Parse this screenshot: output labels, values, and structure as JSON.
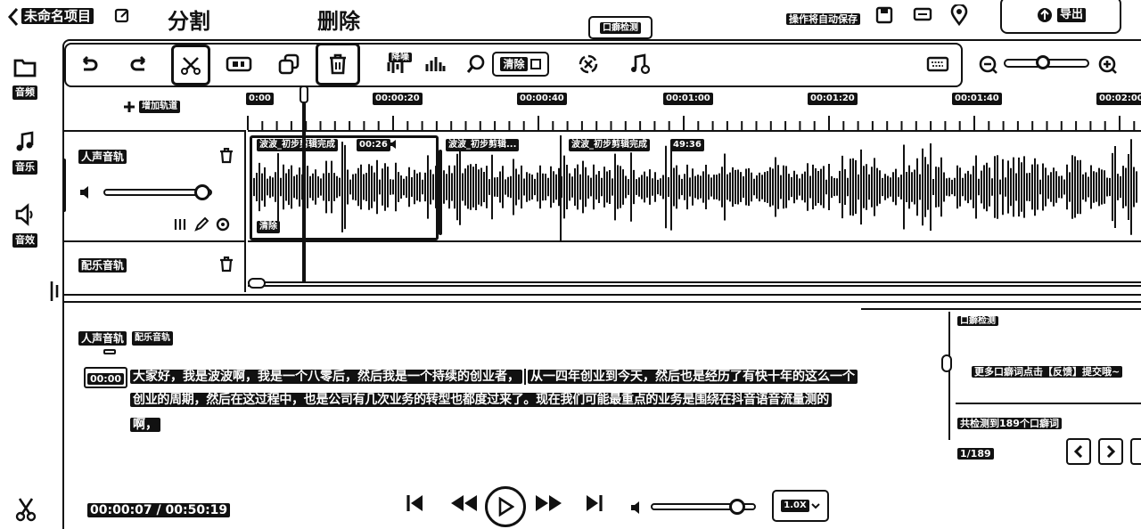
{
  "header": {
    "back_icon": "chevron-left-icon",
    "project_title": "未命名项目",
    "edit_icon": "edit-icon",
    "autosave_text": "操作将自动保存",
    "export_label": "导出",
    "annot_split": "分割",
    "annot_delete": "删除",
    "tooltip": "口癖检测"
  },
  "sidebar": {
    "items": [
      {
        "label": "音频",
        "icon": "folder-icon"
      },
      {
        "label": "音乐",
        "icon": "music-note-icon"
      },
      {
        "label": "音效",
        "icon": "speaker-icon"
      }
    ]
  },
  "toolbar": {
    "denoise_label": "降噪",
    "clear_label": "清除",
    "zoom_level": 0.45
  },
  "timeline": {
    "add_track_label": "增加轨道",
    "ruler": [
      "0:00",
      "00:00:20",
      "00:00:40",
      "00:01:00",
      "00:01:20",
      "00:01:40",
      "00:02:00"
    ],
    "tracks": [
      {
        "name": "人声音轨",
        "volume": 1.0
      },
      {
        "name": "配乐音轨"
      }
    ],
    "clips": [
      {
        "title": "波波_初步剪辑完成",
        "duration": "00:26"
      },
      {
        "title": "波波_初步剪辑..."
      },
      {
        "title": "波波_初步剪辑完成",
        "duration": "49:36"
      }
    ],
    "clip_badge": "清除"
  },
  "transcript": {
    "tabs": [
      "人声音轨",
      "配乐音轨"
    ],
    "timestamp": "00:00",
    "line1": "大家好，我是波波啊，我是一个八零后，然后我是一个持续的创业者，",
    "line1b": "从一四年创业到今天，然后也是经历了有快十年的这么一个",
    "line2": "创业的周期，然后在这过程中，也是公司有几次业务的转型也都度过来了。现在我们可能最重点的业务是围绕在抖音语音流量测的",
    "line3": "啊，"
  },
  "panel": {
    "title": "口癖检测",
    "hint": "更多口癖词点击【反馈】提交哦~",
    "found": "共检测到189个口癖词",
    "page": "1/189"
  },
  "player": {
    "time": "00:00:07 / 00:50:19",
    "speed": "1.0X",
    "volume": 0.9
  }
}
